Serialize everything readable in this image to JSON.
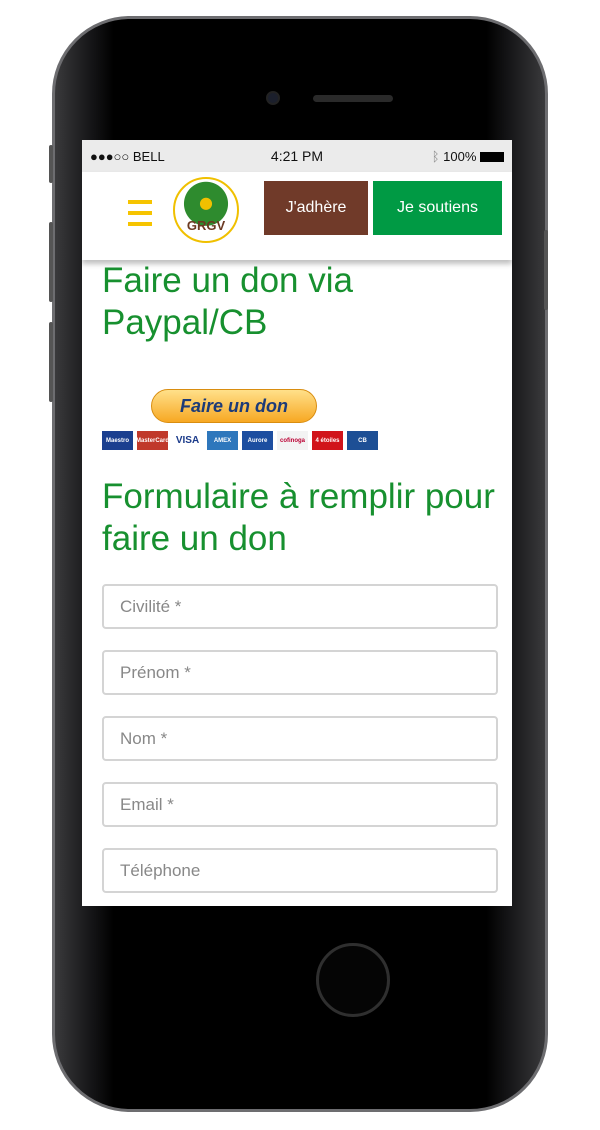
{
  "status": {
    "carrier": "●●●○○ BELL",
    "time": "4:21 PM",
    "battery": "100%"
  },
  "header": {
    "logo_text": "GRGV",
    "adhere_label": "J'adhère",
    "soutiens_label": "Je soutiens"
  },
  "section1": {
    "title": "Faire un don via Paypal/CB",
    "paypal_button": "Faire un don"
  },
  "cards": [
    {
      "name": "Maestro",
      "color": "#1b3f8f"
    },
    {
      "name": "MasterCard",
      "color": "#c0392b"
    },
    {
      "name": "VISA",
      "color": "#ffffff"
    },
    {
      "name": "AMEX",
      "color": "#2e77bc"
    },
    {
      "name": "Aurore",
      "color": "#1d4ea0"
    },
    {
      "name": "cofinoga",
      "color": "#f3f3f3"
    },
    {
      "name": "4 étoiles",
      "color": "#d1141a"
    },
    {
      "name": "CB",
      "color": "#1d4f95"
    }
  ],
  "section2": {
    "title": "Formulaire à remplir pour faire un don"
  },
  "form": {
    "fields": [
      {
        "placeholder": "Civilité *"
      },
      {
        "placeholder": "Prénom *"
      },
      {
        "placeholder": "Nom *"
      },
      {
        "placeholder": "Email *"
      },
      {
        "placeholder": "Téléphone"
      }
    ]
  }
}
